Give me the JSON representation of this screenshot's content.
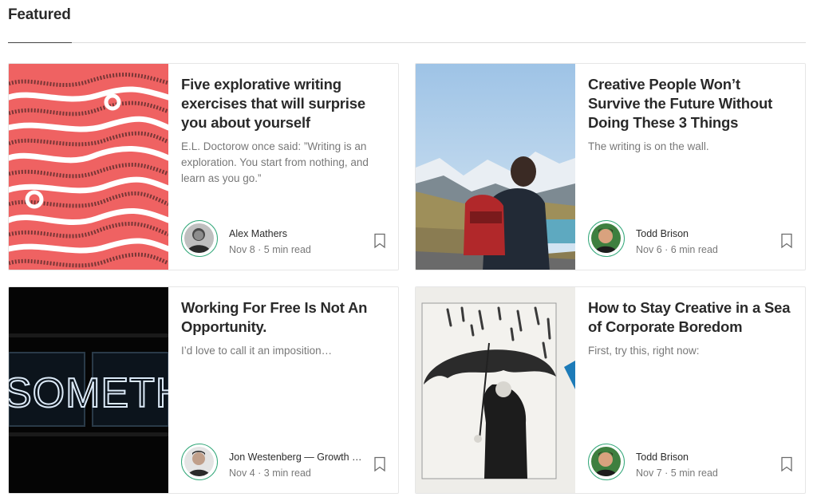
{
  "section": {
    "title": "Featured"
  },
  "cards": [
    {
      "title": "Five explorative writing exercises that will surprise you about yourself",
      "subtitle": "E.L. Doctorow once said: ”Writing is an exploration. You start from nothing, and learn as you go.”",
      "author": "Alex Mathers",
      "date": "Nov 8",
      "read_time": "5 min read",
      "meta_separator": "·",
      "image": "red-wavy-lines",
      "accent": "#ef6262"
    },
    {
      "title": "Creative People Won’t Survive the Future Without Doing These 3 Things",
      "subtitle": "The writing is on the wall.",
      "author": "Todd Brison",
      "date": "Nov 6",
      "read_time": "6 min read",
      "meta_separator": "·",
      "image": "hiker-mountains"
    },
    {
      "title": "Working For Free Is Not An Opportunity.",
      "subtitle": "I’d love to call it an imposition…",
      "author": "Jon Westenberg — Growth …",
      "date": "Nov 4",
      "read_time": "3 min read",
      "meta_separator": "·",
      "image": "neon-sign",
      "image_text": "SOMETHING G"
    },
    {
      "title": "How to Stay Creative in a Sea of Corporate Boredom",
      "subtitle": "First, try this, right now:",
      "author": "Todd Brison",
      "date": "Nov 7",
      "read_time": "5 min read",
      "meta_separator": "·",
      "image": "umbrella-man"
    }
  ],
  "colors": {
    "avatar_ring": "#34a87a",
    "title": "#1f1f1f",
    "muted": "#7a7a7a"
  },
  "icons": {
    "bookmark": "bookmark-icon"
  }
}
